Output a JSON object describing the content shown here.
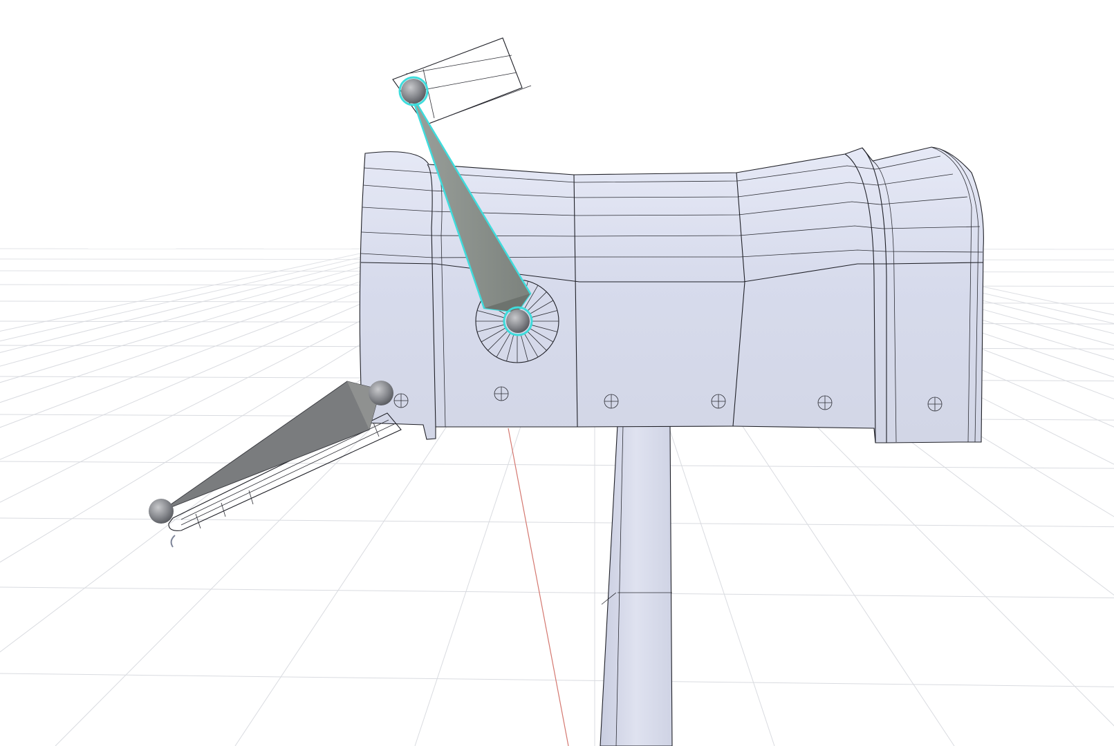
{
  "viewport": {
    "name": "3d-viewport",
    "background": "#ffffff",
    "grid_color": "#d9dbe0",
    "mesh_color": "#dde1f1",
    "wire_color": "#1e1f26",
    "selection_color": "#3fdcdc",
    "bone_color": "#8f9590",
    "axis_color": "#d4776f"
  },
  "scene": {
    "object": "mailbox",
    "parts": [
      "mailbox-body",
      "mailbox-post",
      "mailbox-flag",
      "mailbox-door",
      "rivets"
    ],
    "rig": {
      "bones": [
        {
          "name": "flag-bone",
          "selected": true
        },
        {
          "name": "door-bone",
          "selected": false
        }
      ]
    }
  }
}
